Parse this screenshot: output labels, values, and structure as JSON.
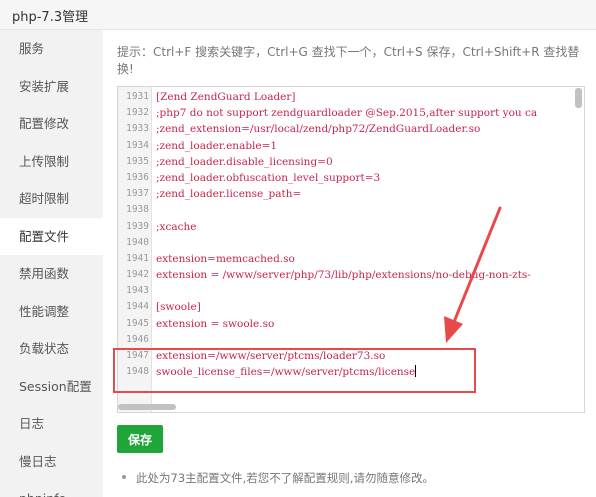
{
  "window": {
    "title": "php-7.3管理"
  },
  "sidebar": {
    "items": [
      {
        "label": "服务",
        "active": false
      },
      {
        "label": "安装扩展",
        "active": false
      },
      {
        "label": "配置修改",
        "active": false
      },
      {
        "label": "上传限制",
        "active": false
      },
      {
        "label": "超时限制",
        "active": false
      },
      {
        "label": "配置文件",
        "active": true
      },
      {
        "label": "禁用函数",
        "active": false
      },
      {
        "label": "性能调整",
        "active": false
      },
      {
        "label": "负载状态",
        "active": false
      },
      {
        "label": "Session配置",
        "active": false
      },
      {
        "label": "日志",
        "active": false
      },
      {
        "label": "慢日志",
        "active": false
      },
      {
        "label": "phpinfo",
        "active": false
      }
    ]
  },
  "main": {
    "tip": "提示：Ctrl+F 搜索关键字，Ctrl+G 查找下一个，Ctrl+S 保存，Ctrl+Shift+R 查找替换!",
    "editor": {
      "lines": [
        {
          "num": "1931",
          "text": "[Zend ZendGuard Loader]"
        },
        {
          "num": "1932",
          "text": ";php7 do not support zendguardloader @Sep.2015,after support you ca"
        },
        {
          "num": "1933",
          "text": ";zend_extension=/usr/local/zend/php72/ZendGuardLoader.so"
        },
        {
          "num": "1934",
          "text": ";zend_loader.enable=1"
        },
        {
          "num": "1935",
          "text": ";zend_loader.disable_licensing=0"
        },
        {
          "num": "1936",
          "text": ";zend_loader.obfuscation_level_support=3"
        },
        {
          "num": "1937",
          "text": ";zend_loader.license_path="
        },
        {
          "num": "1938",
          "text": ""
        },
        {
          "num": "1939",
          "text": ";xcache"
        },
        {
          "num": "1940",
          "text": ""
        },
        {
          "num": "1941",
          "text": "extension=memcached.so"
        },
        {
          "num": "1942",
          "text": "extension = /www/server/php/73/lib/php/extensions/no-debug-non-zts-"
        },
        {
          "num": "1943",
          "text": ""
        },
        {
          "num": "1944",
          "text": "[swoole]"
        },
        {
          "num": "1945",
          "text": "extension = swoole.so"
        },
        {
          "num": "1946",
          "text": ""
        },
        {
          "num": "1947",
          "text": "extension=/www/server/ptcms/loader73.so"
        },
        {
          "num": "1948",
          "text": "swoole_license_files=/www/server/ptcms/license"
        }
      ]
    },
    "save_label": "保存",
    "note": "此处为73主配置文件,若您不了解配置规则,请勿随意修改。"
  },
  "colors": {
    "code_text": "#c7254e",
    "save_button": "#20a53a",
    "annotation": "#e84a4a",
    "sidebar_bg": "#f2f2f2"
  }
}
